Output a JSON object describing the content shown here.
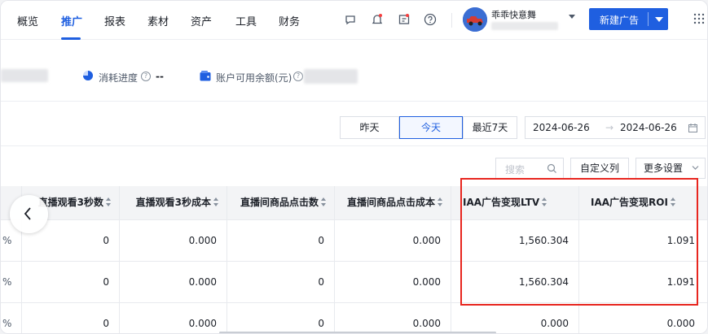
{
  "nav": {
    "items": [
      "概览",
      "推广",
      "报表",
      "素材",
      "资产",
      "工具",
      "财务"
    ],
    "active_index": 1,
    "account_name": "乖乖快意舞",
    "new_ad_label": "新建广告",
    "accent": "#1f5fe0"
  },
  "stats": {
    "consume_label": "消耗进度",
    "consume_value": "--",
    "balance_label": "账户可用余额(元)"
  },
  "filters": {
    "yesterday": "昨天",
    "today": "今天",
    "last7": "最近7天",
    "active": "今天",
    "range_start": "2024-06-26",
    "range_arrow": "→",
    "range_end": "2024-06-26",
    "search_placeholder": "搜索",
    "custom_columns": "自定义列",
    "more_settings": "更多设置"
  },
  "table": {
    "columns": [
      "直播观看3秒数",
      "直播观看3秒成本",
      "直播间商品点击数",
      "直播间商品点击成本",
      "IAA广告变现LTV",
      "IAA广告变现ROI"
    ],
    "rows": [
      {
        "lead": "%",
        "cells": [
          "0",
          "0.000",
          "0",
          "0.000",
          "1,560.304",
          "1.091"
        ]
      },
      {
        "lead": "%",
        "cells": [
          "0",
          "0.000",
          "0",
          "0.000",
          "1,560.304",
          "1.091"
        ]
      },
      {
        "lead": "%",
        "cells": [
          "0",
          "0.000",
          "0",
          "0.000",
          "0.000",
          "0.000"
        ]
      }
    ],
    "highlight_color": "#e8261f"
  }
}
